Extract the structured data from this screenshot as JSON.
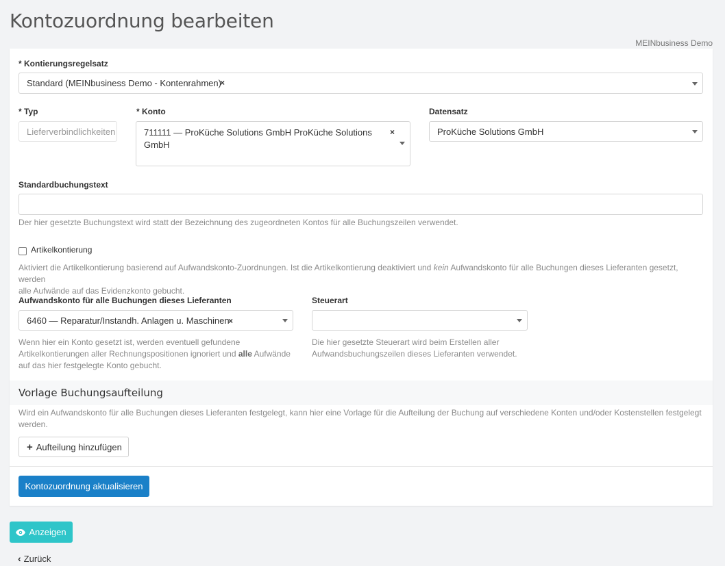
{
  "page": {
    "title": "Kontozuordnung bearbeiten",
    "tenant": "MEINbusiness Demo"
  },
  "form": {
    "ruleset": {
      "label": "* Kontierungsregelsatz",
      "value": "Standard (MEINbusiness Demo - Kontenrahmen)"
    },
    "type": {
      "label": "* Typ",
      "placeholder": "Lieferverbindlichkeiten"
    },
    "account": {
      "label": "* Konto",
      "value_line1": "711111 — ProKüche Solutions GmbH ProKüche Solutions",
      "value_line2": "GmbH"
    },
    "dataset": {
      "label": "Datensatz",
      "value": "ProKüche Solutions GmbH"
    },
    "booking_text": {
      "label": "Standardbuchungstext",
      "value": "",
      "help": "Der hier gesetzte Buchungstext wird statt der Bezeichnung des zugeordneten Kontos für alle Buchungszeilen verwendet."
    },
    "article_assignment": {
      "label": "Artikelkontierung",
      "checked": false,
      "help_part1": "Aktiviert die Artikelkontierung basierend auf Aufwandskonto-Zuordnungen. Ist die Artikelkontierung deaktiviert und ",
      "help_em": "kein",
      "help_part2": " Aufwandskonto für alle Buchungen dieses Lieferanten gesetzt, werden",
      "help_line2": "alle Aufwände auf das Evidenzkonto gebucht."
    },
    "expense_account": {
      "label": "Aufwandskonto für alle Buchungen dieses Lieferanten",
      "value": "6460 — Reparatur/Instandh. Anlagen u. Maschinen",
      "help_line1": "Wenn hier ein Konto gesetzt ist, werden eventuell gefundene",
      "help_line2_a": "Artikelkontierungen aller Rechnungspositionen ignoriert und ",
      "help_line2_b": "alle",
      "help_line2_c": " Aufwände",
      "help_line3": "auf das hier festgelegte Konto gebucht."
    },
    "tax_type": {
      "label": "Steuerart",
      "value": "",
      "help_line1": "Die hier gesetzte Steuerart wird beim Erstellen aller",
      "help_line2": "Aufwandsbuchungszeilen dieses Lieferanten verwendet."
    }
  },
  "split_section": {
    "title": "Vorlage Buchungsaufteilung",
    "help_line1": "Wird ein Aufwandskonto für alle Buchungen dieses Lieferanten festgelegt, kann hier eine Vorlage für die Aufteilung der Buchung auf verschiedene Konten und/oder Kostenstellen festgelegt",
    "help_line2": "werden.",
    "add_button": "Aufteilung hinzufügen"
  },
  "actions": {
    "submit": "Kontozuordnung aktualisieren",
    "show": "Anzeigen",
    "back": "Zurück"
  },
  "icons": {
    "clear": "×",
    "plus": "plus-icon",
    "eye": "eye-icon",
    "chevron_left": "chevron-left-icon",
    "caret_down": "caret-down-icon"
  },
  "colors": {
    "primary": "#1a80c8",
    "info": "#2ec5c9"
  }
}
